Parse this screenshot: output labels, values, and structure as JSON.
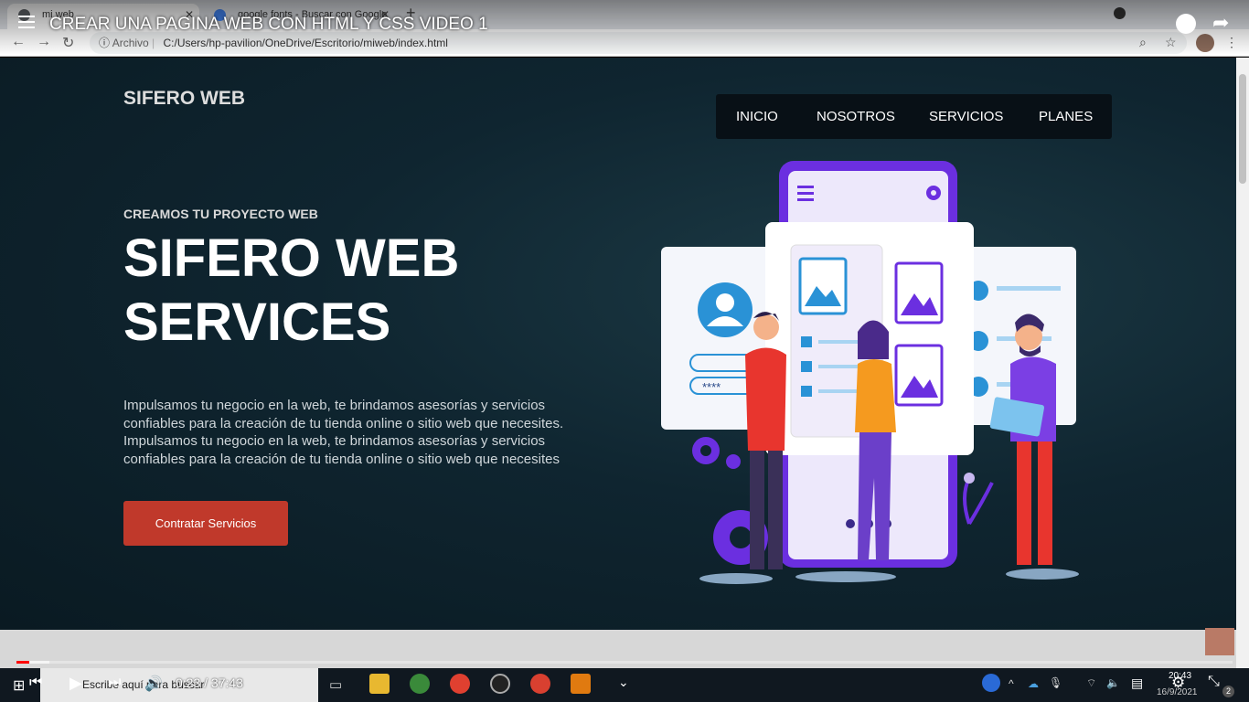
{
  "browser": {
    "tabs": [
      {
        "title": "mi web",
        "active": true
      },
      {
        "title": "google fonts - Buscar con Google",
        "active": false
      }
    ],
    "address_label": "Archivo",
    "url": "C:/Users/hp-pavilion/OneDrive/Escritorio/miweb/index.html"
  },
  "video": {
    "title": "CREAR UNA PAGINA WEB CON HTML Y CSS VIDEO 1",
    "time": "0:23 / 37:43"
  },
  "site": {
    "logo": "SIFERO WEB",
    "nav": [
      "INICIO",
      "NOSOTROS",
      "SERVICIOS",
      "PLANES"
    ],
    "kicker": "CREAMOS TU PROYECTO WEB",
    "headline_line1": "SIFERO WEB",
    "headline_line2": "SERVICES",
    "description": "Impulsamos tu negocio en la web, te brindamos asesorías y servicios confiables para la creación de tu tienda online o sitio web que necesites. Impulsamos tu negocio en la web, te brindamos asesorías y servicios confiables para la creación de tu tienda online o sitio web que necesites",
    "cta": "Contratar Servicios",
    "password_mask": "****"
  },
  "taskbar": {
    "search_placeholder": "Escribe aquí para buscar",
    "time": "20:43",
    "date": "16/9/2021",
    "notifications": "2"
  },
  "colors": {
    "accent": "#c0392b",
    "nav_bg": "#081016",
    "purple": "#7b3fe4"
  }
}
